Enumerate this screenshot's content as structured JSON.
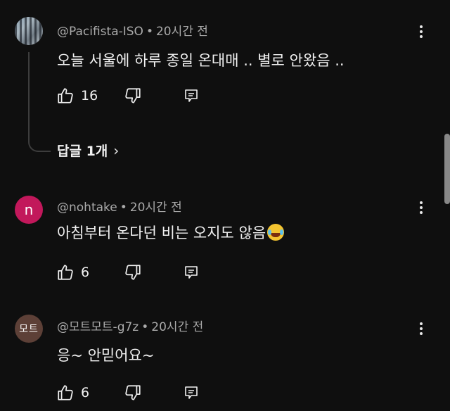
{
  "comments": [
    {
      "avatar_text": "",
      "handle": "@Pacifista-ISO",
      "time": "20시간 전",
      "text": "오늘 서울에 하루 종일 온대매 .. 별로 안왔음 ..",
      "likes": "16",
      "replies_label": "답글 1개"
    },
    {
      "avatar_text": "n",
      "handle": "@nohtake",
      "time": "20시간 전",
      "text": "아침부터 온다던 비는 오지도 않음",
      "likes": "6"
    },
    {
      "avatar_text": "모트",
      "handle": "@모트모트-g7z",
      "time": "20시간 전",
      "text": "응~ 안믿어요~",
      "likes": "6"
    }
  ],
  "separator": "•",
  "chevron": "›",
  "icons": [
    "thumbs-up-icon",
    "thumbs-down-icon",
    "reply-icon",
    "more-vert-icon",
    "chevron-right-icon",
    "laughing-emoji-icon"
  ],
  "colors": {
    "background": "#0f0f0f",
    "text": "#f1f1f1",
    "meta": "#aaaaaa",
    "avatar_n": "#c2185b",
    "avatar_mote": "#5d4037"
  }
}
